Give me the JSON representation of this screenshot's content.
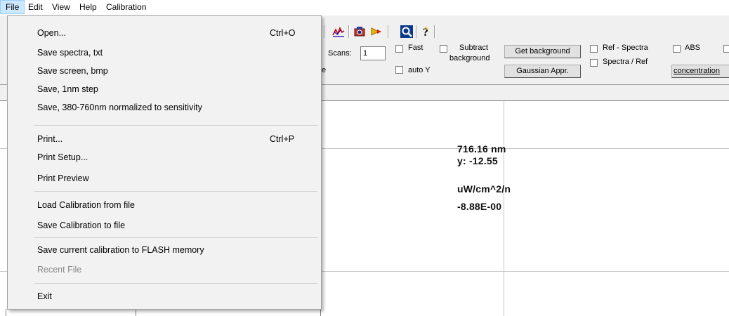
{
  "menubar": {
    "items": [
      {
        "label": "File"
      },
      {
        "label": "Edit"
      },
      {
        "label": "View"
      },
      {
        "label": "Help"
      },
      {
        "label": "Calibration"
      }
    ]
  },
  "file_menu": {
    "items": [
      {
        "label": "Open...",
        "shortcut": "Ctrl+O"
      },
      {
        "label": "Save spectra, txt"
      },
      {
        "label": "Save screen, bmp"
      },
      {
        "label": "Save, 1nm step"
      },
      {
        "label": "Save, 380-760nm normalized to sensitivity"
      },
      {
        "label": "Print...",
        "shortcut": "Ctrl+P"
      },
      {
        "label": "Print Setup..."
      },
      {
        "label": "Print Preview"
      },
      {
        "label": "Load Calibration from file"
      },
      {
        "label": "Save Calibration to file"
      },
      {
        "label": "Save current calibration to FLASH memory"
      },
      {
        "label": "Recent File",
        "disabled": true
      },
      {
        "label": "Exit"
      }
    ]
  },
  "toolbar": {
    "icons": [
      "spectrum-icon",
      "camera-icon",
      "arrow-icon",
      "zoom-icon",
      "help-icon"
    ],
    "scans_label": "Scans:",
    "scans_value": "1",
    "fast_label": "Fast",
    "auto_y_label": "auto Y",
    "subtract_label_1": "Subtract",
    "subtract_label_2": "background",
    "get_background_label": "Get background",
    "gaussian_label": "Gaussian Appr.",
    "ref_spectra_label": "Ref - Spectra",
    "spectra_ref_label": "Spectra / Ref",
    "abs_label": "ABS",
    "concentration_label": "concentration",
    "cut_label": "e"
  },
  "plot": {
    "wavelength_readout": "716.16 nm",
    "y_readout": "y: -12.55",
    "unit_readout": "uW/cm^2/n",
    "value_readout": "-8.88E-00"
  }
}
